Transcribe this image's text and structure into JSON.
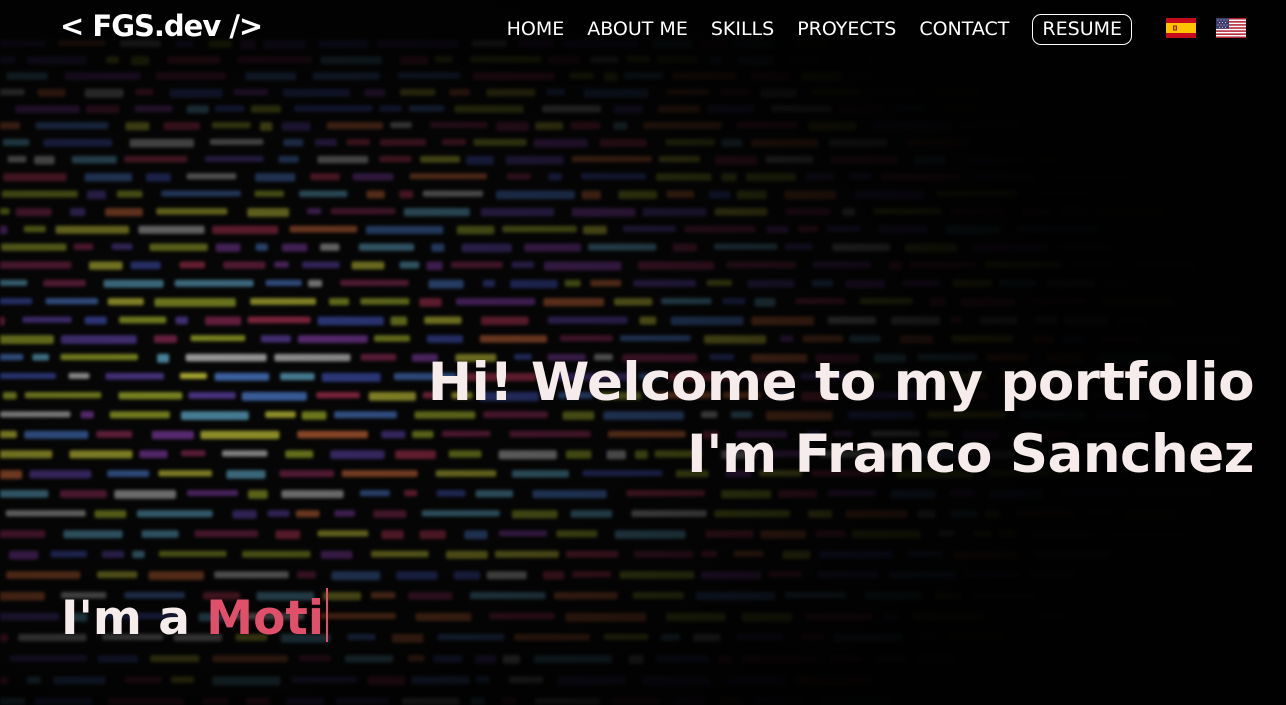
{
  "navbar": {
    "logo": "< FGS.dev />",
    "links": [
      "HOME",
      "ABOUT ME",
      "SKILLS",
      "PROYECTS",
      "CONTACT"
    ],
    "resume_label": "RESUME",
    "flags": [
      "spain-flag-icon",
      "usa-flag-icon"
    ]
  },
  "hero": {
    "line1": "Hi! Welcome to my portfolio",
    "line2": "I'm Franco Sanchez",
    "typed_prefix": "I'm a ",
    "typed_word": "Moti"
  },
  "colors": {
    "accent": "#e0506a",
    "text": "#f7ecec",
    "background": "#060606"
  }
}
